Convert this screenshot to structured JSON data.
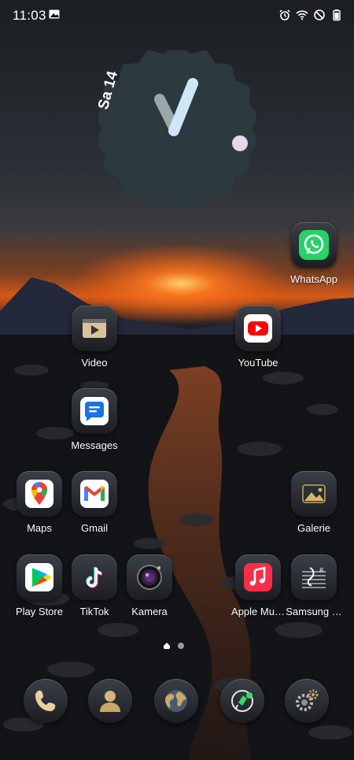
{
  "status_bar": {
    "time": "11:03",
    "icons": [
      "gallery-icon",
      "alarm-icon",
      "wifi-icon",
      "dnd-icon",
      "battery-icon"
    ]
  },
  "clock_widget": {
    "date": "Sa 14",
    "colors": {
      "face": "#2c3a3f",
      "hour": "#9aa7ab",
      "minute": "#cde7f7",
      "dot": "#e4d6ec"
    }
  },
  "apps": [
    {
      "id": "whatsapp",
      "label": "WhatsApp",
      "icon": "whatsapp-icon"
    },
    {
      "id": "video",
      "label": "Video",
      "icon": "video-icon"
    },
    {
      "id": "youtube",
      "label": "YouTube",
      "icon": "youtube-icon"
    },
    {
      "id": "messages",
      "label": "Messages",
      "icon": "messages-icon"
    },
    {
      "id": "maps",
      "label": "Maps",
      "icon": "maps-icon"
    },
    {
      "id": "gmail",
      "label": "Gmail",
      "icon": "gmail-icon"
    },
    {
      "id": "galerie",
      "label": "Galerie",
      "icon": "gallery-icon"
    },
    {
      "id": "playstore",
      "label": "Play Store",
      "icon": "play-store-icon"
    },
    {
      "id": "tiktok",
      "label": "TikTok",
      "icon": "tiktok-icon"
    },
    {
      "id": "kamera",
      "label": "Kamera",
      "icon": "camera-icon"
    },
    {
      "id": "applemusic",
      "label": "Apple Mu…",
      "icon": "music-icon"
    },
    {
      "id": "samsungmusic",
      "label": "Samsung …",
      "icon": "samsung-music-icon"
    }
  ],
  "dock": [
    {
      "id": "phone",
      "icon": "phone-icon"
    },
    {
      "id": "contacts",
      "icon": "contacts-icon"
    },
    {
      "id": "browser",
      "icon": "globe-icon"
    },
    {
      "id": "messaging",
      "icon": "chat-icon"
    },
    {
      "id": "settings",
      "icon": "settings-icon"
    }
  ],
  "page_indicator": {
    "pages": 2,
    "current": 0
  }
}
